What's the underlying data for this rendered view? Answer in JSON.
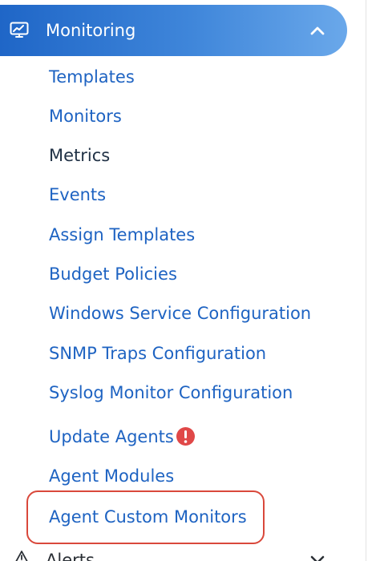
{
  "section": {
    "title": "Monitoring",
    "icon": "monitor-chart-icon",
    "collapse_icon": "chevron-up-icon",
    "accent": "#2f74d0"
  },
  "items": [
    {
      "label": "Templates"
    },
    {
      "label": "Monitors"
    },
    {
      "label": "Metrics",
      "active": true
    },
    {
      "label": "Events"
    },
    {
      "label": "Assign Templates"
    },
    {
      "label": "Budget Policies"
    },
    {
      "label": "Windows Service Configuration"
    },
    {
      "label": "SNMP Traps Configuration"
    },
    {
      "label": "Syslog Monitor Configuration"
    },
    {
      "label": "Update Agents",
      "badge_icon": "alert-circle-icon"
    },
    {
      "label": "Agent Modules"
    },
    {
      "label": "Agent Custom Monitors",
      "highlighted": true
    }
  ],
  "next_section": {
    "title": "Alerts",
    "icon": "warning-triangle-icon",
    "expand_icon": "chevron-down-icon"
  },
  "colors": {
    "link": "#1e63c2",
    "active_text": "#213246",
    "highlight_border": "#d9483b",
    "badge": "#e04848"
  }
}
